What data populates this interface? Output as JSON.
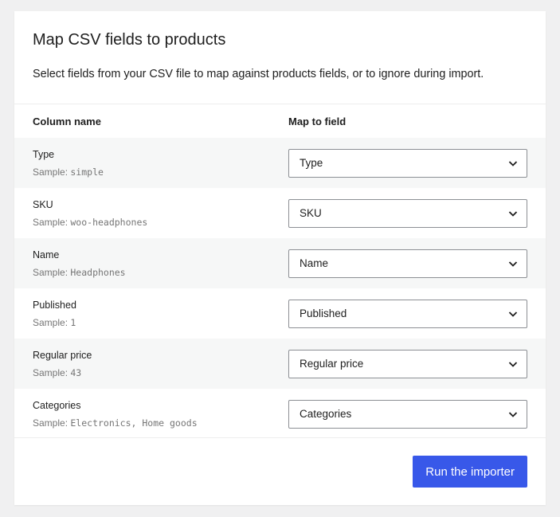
{
  "header": {
    "title": "Map CSV fields to products",
    "description": "Select fields from your CSV file to map against products fields, or to ignore during import."
  },
  "table": {
    "col_name_header": "Column name",
    "map_header": "Map to field",
    "sample_prefix": "Sample:",
    "rows": [
      {
        "name": "Type",
        "sample": "simple",
        "mapped": "Type"
      },
      {
        "name": "SKU",
        "sample": "woo-headphones",
        "mapped": "SKU"
      },
      {
        "name": "Name",
        "sample": "Headphones",
        "mapped": "Name"
      },
      {
        "name": "Published",
        "sample": "1",
        "mapped": "Published"
      },
      {
        "name": "Regular price",
        "sample": "43",
        "mapped": "Regular price"
      },
      {
        "name": "Categories",
        "sample": "Electronics, Home goods",
        "mapped": "Categories"
      }
    ]
  },
  "footer": {
    "run_label": "Run the importer"
  },
  "colors": {
    "accent": "#3858e9",
    "row_alt_bg": "#f6f7f7",
    "sample_text": "#757575"
  },
  "icons": {
    "select_arrow": "chevron-down-icon"
  }
}
